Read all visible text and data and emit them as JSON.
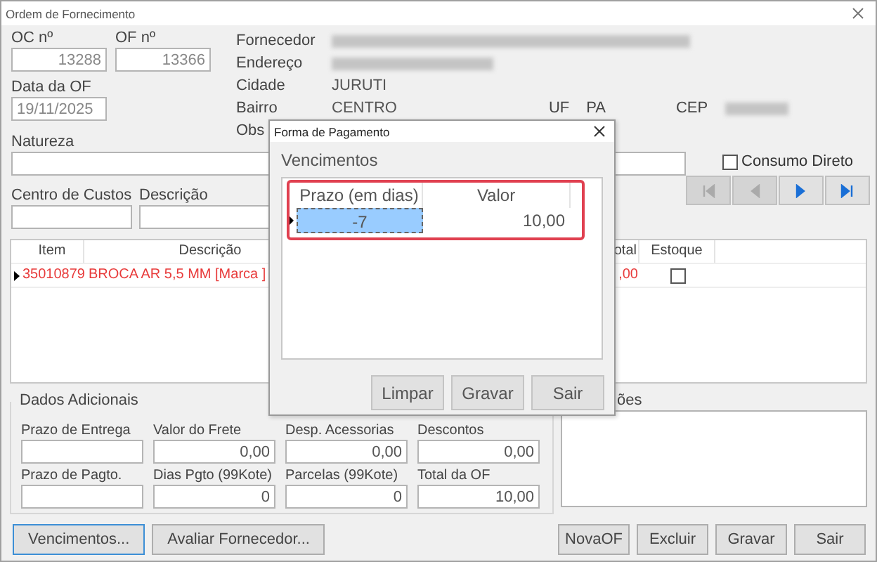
{
  "window": {
    "title": "Ordem de Fornecimento"
  },
  "header_fields": [
    {
      "label": "OC nº",
      "value": "13288"
    },
    {
      "label": "OF nº",
      "value": "13366"
    },
    {
      "label": "Data da OF",
      "value": "19/11/2025"
    }
  ],
  "supplier": [
    {
      "label": "Fornecedor",
      "kind": "redacted"
    },
    {
      "label": "Endereço",
      "kind": "redacted"
    },
    {
      "label": "Cidade",
      "kind": "text",
      "value": "JURUTI"
    },
    {
      "label": "Bairro",
      "kind": "text",
      "value": "CENTRO"
    },
    {
      "label": "Obs",
      "kind": "empty"
    }
  ],
  "location": {
    "uf_label": "UF",
    "uf": "PA",
    "cep_label": "CEP"
  },
  "natureza": {
    "label": "Natureza"
  },
  "consumo_direto": {
    "label": "Consumo Direto",
    "checked": false
  },
  "nav_buttons": [
    {
      "kind": "first",
      "disabled": true
    },
    {
      "kind": "prev",
      "disabled": true
    },
    {
      "kind": "next",
      "disabled": false
    },
    {
      "kind": "last",
      "disabled": false
    }
  ],
  "cost_center": {
    "label": "Centro de Custos"
  },
  "description": {
    "label": "Descrição"
  },
  "items_grid": {
    "columns": [
      "Item",
      "Descrição",
      "otal",
      "Estoque"
    ],
    "rows": [
      {
        "item": "35010879",
        "descricao": "BROCA AR 5,5 MM [Marca ]",
        "total": ",00",
        "estoque": false,
        "current": true
      }
    ]
  },
  "dados_adicionais": {
    "title": "Dados Adicionais",
    "fields": [
      {
        "label": "Prazo de Entrega"
      },
      {
        "label": "Valor do Frete",
        "value": "0,00"
      },
      {
        "label": "Desp. Acessorias",
        "value": "0,00"
      },
      {
        "label": "Descontos",
        "value": "0,00"
      },
      {
        "label": "Prazo de Pagto."
      },
      {
        "label": "Dias Pgto (99Kote)",
        "value": "0"
      },
      {
        "label": "Parcelas (99Kote)",
        "value": "0"
      },
      {
        "label": "Total da OF",
        "value": "10,00"
      }
    ]
  },
  "observacoes": {
    "label": "ões"
  },
  "buttons_left": [
    {
      "label": "Vencimentos...",
      "focused": true
    },
    {
      "label": "Avaliar Fornecedor...",
      "focused": false
    }
  ],
  "buttons_right": [
    "NovaOF",
    "Excluir",
    "Gravar",
    "Sair"
  ],
  "dialog": {
    "title": "Forma de Pagamento",
    "section": "Vencimentos",
    "columns": [
      "Prazo (em dias)",
      "Valor"
    ],
    "rows": [
      {
        "prazo": "-7",
        "valor": "10,00",
        "selected": true
      }
    ],
    "buttons": [
      "Limpar",
      "Gravar",
      "Sair"
    ]
  }
}
